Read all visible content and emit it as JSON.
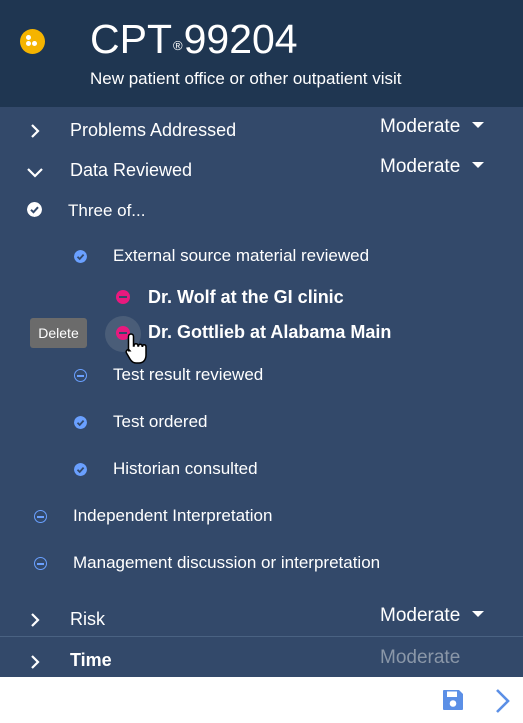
{
  "header": {
    "code_prefix": "CPT",
    "code_reg": "®",
    "code_number": "99204",
    "subtitle": "New patient office or other outpatient visit",
    "logo_icon": "dots-logo-icon"
  },
  "sections": {
    "problems": {
      "label": "Problems Addressed",
      "level": "Moderate"
    },
    "data": {
      "label": "Data Reviewed",
      "level": "Moderate"
    },
    "risk": {
      "label": "Risk",
      "level": "Moderate"
    },
    "time": {
      "label": "Time",
      "level": "Moderate"
    }
  },
  "data_reviewed": {
    "group_label": "Three of...",
    "items": [
      {
        "label": "External source material reviewed",
        "state": "checked"
      },
      {
        "label": "Test result reviewed",
        "state": "unchecked"
      },
      {
        "label": "Test ordered",
        "state": "checked"
      },
      {
        "label": "Historian consulted",
        "state": "checked"
      }
    ],
    "sources": [
      {
        "label": "Dr. Wolf at the GI clinic"
      },
      {
        "label": "Dr. Gottlieb at Alabama Main"
      }
    ],
    "other": [
      {
        "label": "Independent Interpretation",
        "state": "unchecked"
      },
      {
        "label": "Management discussion or interpretation",
        "state": "unchecked"
      }
    ]
  },
  "tooltip": {
    "label": "Delete"
  },
  "colors": {
    "header_bg": "#1f3651",
    "panel_bg": "#33496a",
    "accent_blue": "#6aa0ff",
    "delete_pink": "#e8197e",
    "logo_yellow": "#f5b400"
  },
  "footer": {
    "save_icon": "save-icon",
    "next_icon": "chevron-right-icon"
  }
}
